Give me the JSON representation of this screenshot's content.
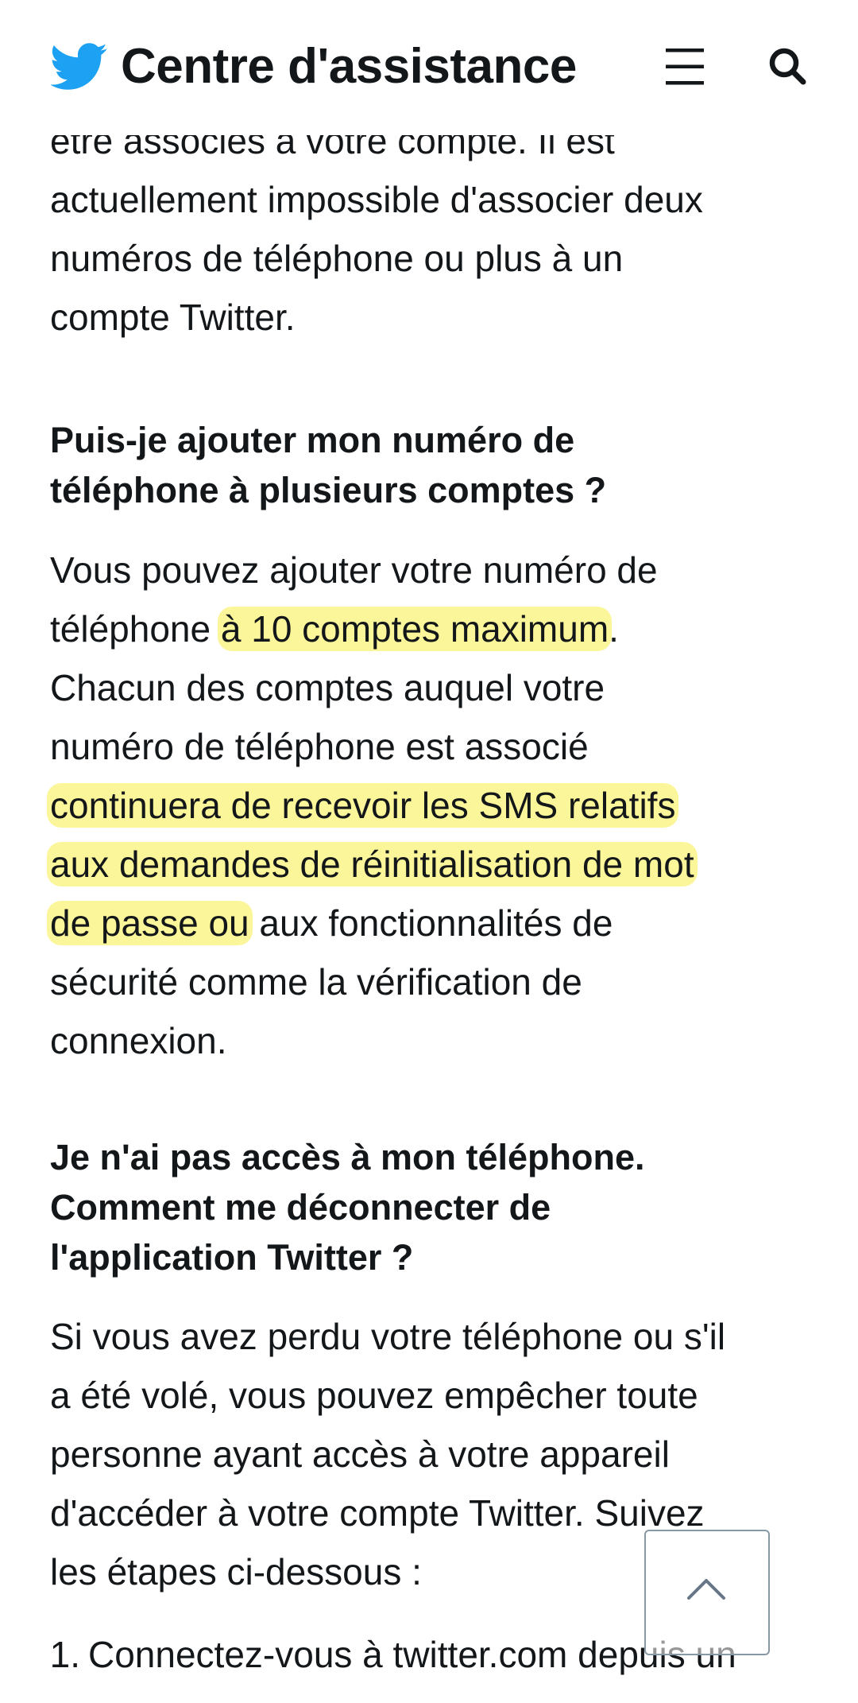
{
  "header": {
    "title": "Centre d'assistance",
    "logo_icon": "twitter-bird-icon",
    "menu_icon": "hamburger-menu-icon",
    "search_icon": "search-icon",
    "brand_color": "#1da1f2"
  },
  "article": {
    "intro_cut_line": "être associés à votre compte. Il est",
    "intro": {
      "l1": "actuellement impossible d'associer deux",
      "l2": "numéros de téléphone ou plus à un",
      "l3": "compte Twitter."
    },
    "section1": {
      "heading_l1": "Puis-je ajouter mon numéro de",
      "heading_l2": "téléphone à plusieurs comptes ?",
      "p_l1": "Vous pouvez ajouter votre numéro de",
      "p_l2_pre": "téléphone ",
      "p_l2_hl": "à 10 comptes maximum",
      "p_l2_post": ".",
      "p_l3": "Chacun des comptes auquel votre",
      "p_l4": "numéro de téléphone est associé",
      "p_l5_hl": "continuera de recevoir les SMS relatifs",
      "p_l6_hl": "aux demandes de réinitialisation de mot",
      "p_l7_hl": "de passe ou",
      "p_l7_post": " aux fonctionnalités de",
      "p_l8": "sécurité comme la vérification de",
      "p_l9": "connexion."
    },
    "section2": {
      "heading_l1": "Je n'ai pas accès à mon téléphone.",
      "heading_l2": "Comment me déconnecter de",
      "heading_l3": "l'application Twitter ?",
      "p_l1": "Si vous avez perdu votre téléphone ou s'il",
      "p_l2": "a été volé, vous pouvez empêcher toute",
      "p_l3": "personne ayant accès à votre appareil",
      "p_l4": "d'accéder à votre compte Twitter. Suivez",
      "p_l5": "les étapes ci-dessous :",
      "steps": [
        {
          "num": "1.",
          "text": "Connectez-vous à twitter.com depuis un"
        }
      ]
    },
    "highlight_color": "#f8f05c"
  },
  "back_to_top": {
    "icon": "chevron-up-icon"
  }
}
